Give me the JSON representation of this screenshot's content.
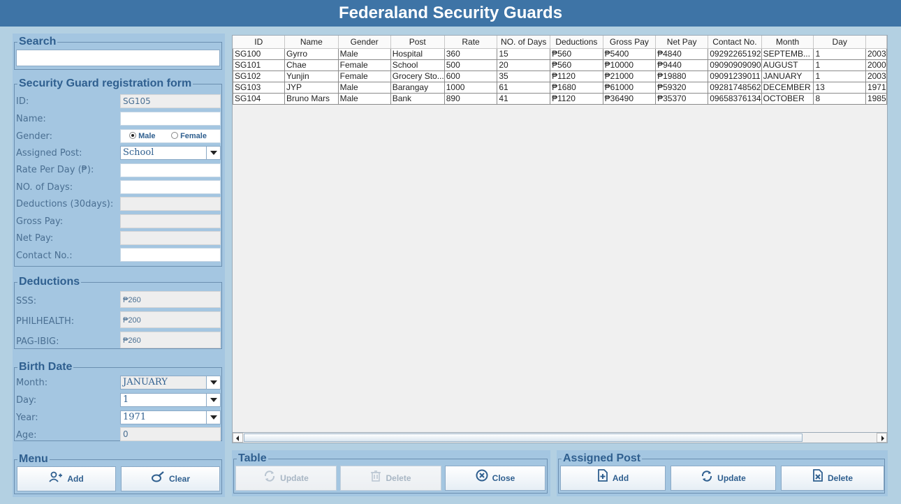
{
  "app": {
    "title": "Federaland Security Guards"
  },
  "search": {
    "title": "Search",
    "value": ""
  },
  "form": {
    "title": "Security Guard registration form",
    "labels": {
      "id": "ID:",
      "name": "Name:",
      "gender": "Gender:",
      "post": "Assigned Post:",
      "rate": "Rate Per Day (₱):",
      "days": "NO. of Days:",
      "deductions": "Deductions (30days):",
      "gross": "Gross Pay:",
      "net": "Net Pay:",
      "contact": "Contact No.:"
    },
    "values": {
      "id": "SG105",
      "name": "",
      "post": "School",
      "rate": "",
      "days": "",
      "deductions": "",
      "gross": "",
      "net": "",
      "contact": ""
    },
    "gender_options": {
      "male": "Male",
      "female": "Female",
      "selected": "Male"
    }
  },
  "deductions": {
    "title": "Deductions",
    "items": [
      {
        "label": "SSS:",
        "value": "₱260"
      },
      {
        "label": "PHILHEALTH:",
        "value": "₱200"
      },
      {
        "label": "PAG-IBIG:",
        "value": "₱260"
      }
    ]
  },
  "birth": {
    "title": "Birth Date",
    "labels": {
      "month": "Month:",
      "day": "Day:",
      "year": "Year:",
      "age": "Age:"
    },
    "values": {
      "month": "JANUARY",
      "day": "1",
      "year": "1971",
      "age": "0"
    }
  },
  "menu": {
    "title": "Menu",
    "add": "Add",
    "clear": "Clear"
  },
  "table_group": {
    "title": "Table",
    "update": "Update",
    "delete": "Delete",
    "close": "Close"
  },
  "post_group": {
    "title": "Assigned Post",
    "add": "Add",
    "update": "Update",
    "delete": "Delete"
  },
  "table": {
    "columns": [
      "ID",
      "Name",
      "Gender",
      "Post",
      "Rate",
      "NO. of Days",
      "Deductions",
      "Gross Pay",
      "Net Pay",
      "Contact No.",
      "Month",
      "Day",
      ""
    ],
    "rows": [
      [
        "SG100",
        "Gyrro",
        "Male",
        "Hospital",
        "360",
        "15",
        "₱560",
        "₱5400",
        "₱4840",
        "09292265192",
        "SEPTEMB...",
        "1",
        "2003"
      ],
      [
        "SG101",
        "Chae",
        "Female",
        "School",
        "500",
        "20",
        "₱560",
        "₱10000",
        "₱9440",
        "09090909090",
        "AUGUST",
        "1",
        "2000"
      ],
      [
        "SG102",
        "Yunjin",
        "Female",
        "Grocery Sto...",
        "600",
        "35",
        "₱1120",
        "₱21000",
        "₱19880",
        "09091239011",
        "JANUARY",
        "1",
        "2003"
      ],
      [
        "SG103",
        "JYP",
        "Male",
        "Barangay",
        "1000",
        "61",
        "₱1680",
        "₱61000",
        "₱59320",
        "09281748562",
        "DECEMBER",
        "13",
        "1971"
      ],
      [
        "SG104",
        "Bruno Mars",
        "Male",
        "Bank",
        "890",
        "41",
        "₱1120",
        "₱36490",
        "₱35370",
        "09658376134",
        "OCTOBER",
        "8",
        "1985"
      ]
    ]
  }
}
